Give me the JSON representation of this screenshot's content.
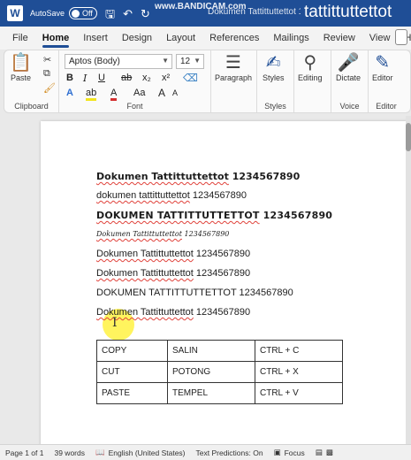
{
  "titlebar": {
    "autosave_label": "AutoSave",
    "autosave_state": "Off",
    "doc_title": "Dokumen Tattittuttettot 1",
    "watermark": "www.BANDICAM.com",
    "overlay_text": "tattittuttettot"
  },
  "menu": {
    "tabs": [
      "File",
      "Home",
      "Insert",
      "Design",
      "Layout",
      "References",
      "Mailings",
      "Review",
      "View",
      "Help"
    ],
    "active": "Home"
  },
  "ribbon": {
    "paste_label": "Paste",
    "clipboard_label": "Clipboard",
    "font_name": "Aptos (Body)",
    "font_size": "12",
    "font_label": "Font",
    "paragraph_label": "Paragraph",
    "styles_label": "Styles",
    "styles_group_label": "Styles",
    "editing_label": "Editing",
    "dictate_label": "Dictate",
    "voice_label": "Voice",
    "editor_label": "Editor",
    "editor_group_label": "Editor",
    "bold": "B",
    "italic": "I",
    "underline": "U",
    "strike": "ab",
    "subscript": "x₂",
    "superscript": "x²",
    "text_effects": "A",
    "highlight": "ab",
    "font_color": "A",
    "change_case": "Aa",
    "grow_font": "A",
    "shrink_font": "A"
  },
  "document": {
    "lines": [
      {
        "word": "Dokumen Tattittuttettot",
        "rest": " 1234567890"
      },
      {
        "word": "dokumen tattittuttettot",
        "rest": " 1234567890"
      },
      {
        "word": "DOKUMEN TATTITTUTTETTOT",
        "rest": " 1234567890"
      },
      {
        "word": "Dokumen Tattittuttettot",
        "rest": " 1234567890"
      },
      {
        "word": "Dokumen Tattittuttettot",
        "rest": " 1234567890"
      },
      {
        "word": "Dokumen Tattittuttettot",
        "rest": " 1234567890"
      },
      {
        "word": "DOKUMEN TATTITTUTTETTOT",
        "rest": " 1234567890"
      },
      {
        "word": "Dokumen Tattittuttettot",
        "rest": " 1234567890"
      }
    ],
    "table": [
      [
        "COPY",
        "SALIN",
        "CTRL + C"
      ],
      [
        "CUT",
        "POTONG",
        "CTRL + X"
      ],
      [
        "PASTE",
        "TEMPEL",
        "CTRL + V"
      ]
    ]
  },
  "statusbar": {
    "page": "Page 1 of 1",
    "words": "39 words",
    "language": "English (United States)",
    "predictions": "Text Predictions: On",
    "focus": "Focus"
  }
}
